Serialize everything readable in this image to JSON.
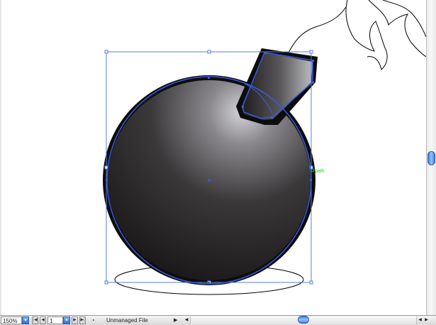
{
  "artboard": {
    "anchor_label": "path"
  },
  "statusbar": {
    "zoom_value": "150%",
    "zoom_dropdown_glyph": "▾",
    "first_page_glyph": "|◀",
    "prev_page_glyph": "◀",
    "page_value": "1",
    "page_dropdown_glyph": "▾",
    "next_page_glyph": "▶",
    "last_page_glyph": "▶|",
    "status_icon_glyph": "◔",
    "file_status": "Unmanaged File",
    "status_arrow_glyph": "▶",
    "scroll_left_glyph": "◀",
    "scroll_right_glyph_1": "◀",
    "scroll_right_glyph_2": "▶"
  },
  "colors": {
    "selection": "#3b5bdb",
    "bomb_dark": "#101010",
    "bomb_highlight": "#c8c8cc",
    "smart_guide": "#28c828"
  }
}
